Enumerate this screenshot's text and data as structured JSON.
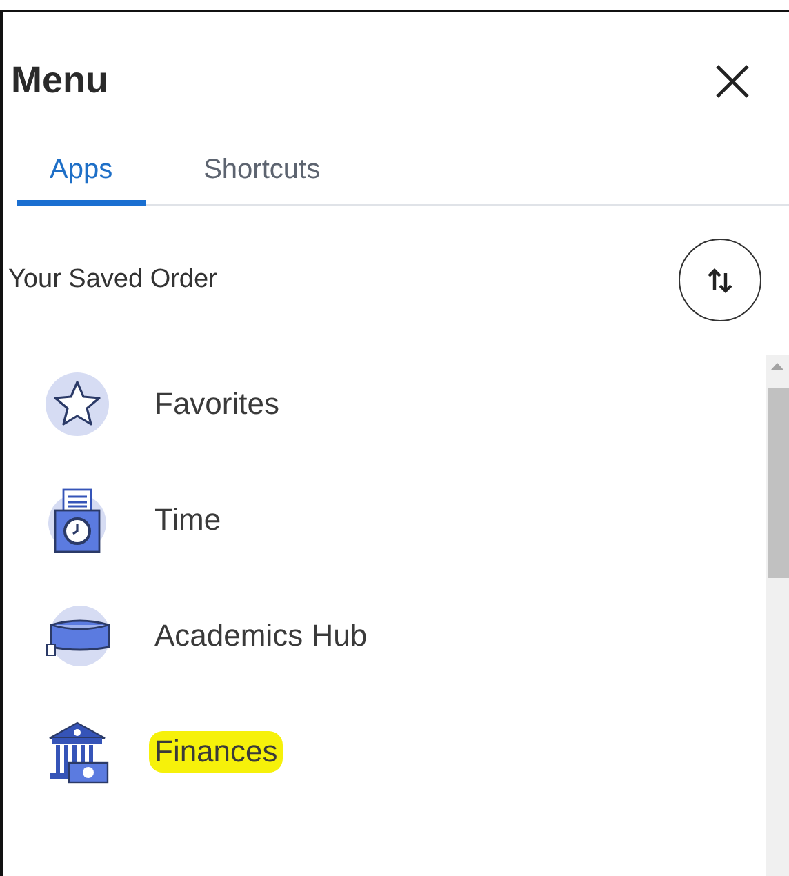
{
  "header": {
    "title": "Menu"
  },
  "tabs": [
    {
      "label": "Apps",
      "selected": true
    },
    {
      "label": "Shortcuts",
      "selected": false
    }
  ],
  "order": {
    "label": "Your Saved Order"
  },
  "apps": [
    {
      "kind": "star",
      "label": "Favorites",
      "highlighted": false
    },
    {
      "kind": "clock",
      "label": "Time",
      "highlighted": false
    },
    {
      "kind": "cap",
      "label": "Academics Hub",
      "highlighted": false
    },
    {
      "kind": "bank",
      "label": "Finances",
      "highlighted": true
    }
  ]
}
